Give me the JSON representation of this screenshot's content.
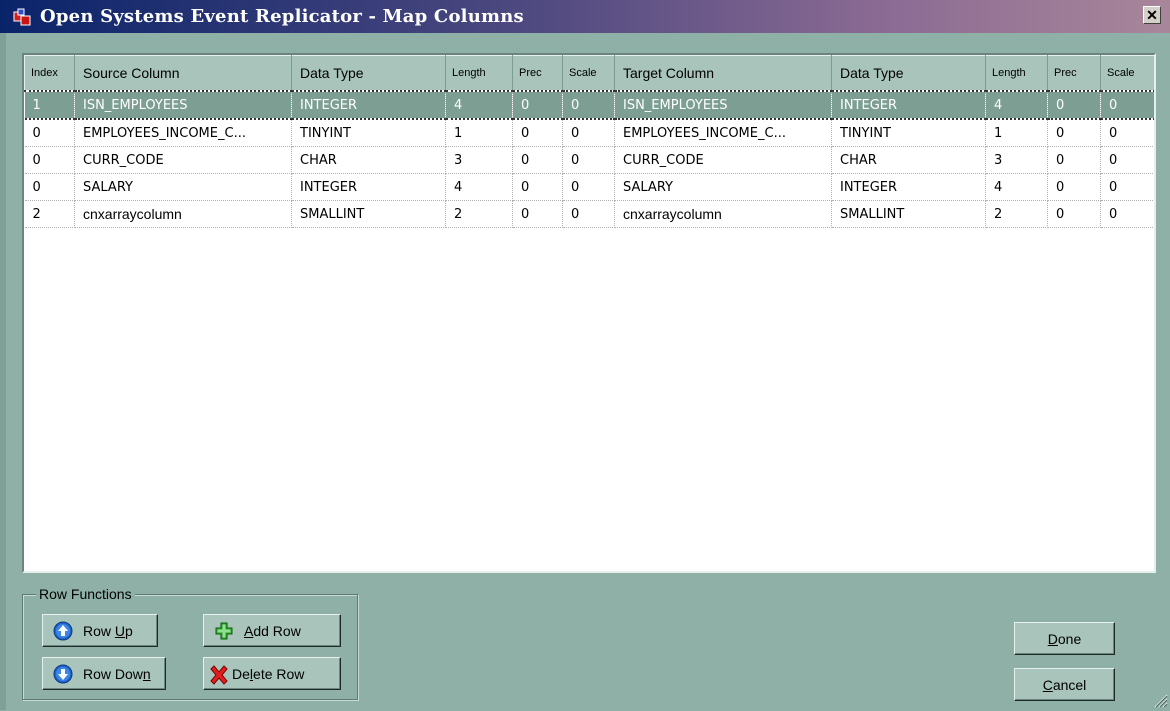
{
  "window": {
    "title": "Open Systems Event Replicator - Map Columns",
    "close_glyph": "✕"
  },
  "grid": {
    "columns": [
      "Index",
      "Source Column",
      "Data Type",
      "Length",
      "Prec",
      "Scale",
      "Target Column",
      "Data Type",
      "Length",
      "Prec",
      "Scale"
    ],
    "rows": [
      [
        "1",
        "ISN_EMPLOYEES",
        "INTEGER",
        "4",
        "0",
        "0",
        "ISN_EMPLOYEES",
        "INTEGER",
        "4",
        "0",
        "0"
      ],
      [
        "0",
        "EMPLOYEES_INCOME_C...",
        "TINYINT",
        "1",
        "0",
        "0",
        "EMPLOYEES_INCOME_C...",
        "TINYINT",
        "1",
        "0",
        "0"
      ],
      [
        "0",
        "CURR_CODE",
        "CHAR",
        "3",
        "0",
        "0",
        "CURR_CODE",
        "CHAR",
        "3",
        "0",
        "0"
      ],
      [
        "0",
        "SALARY",
        "INTEGER",
        "4",
        "0",
        "0",
        "SALARY",
        "INTEGER",
        "4",
        "0",
        "0"
      ],
      [
        "2",
        "cnxarraycolumn",
        "SMALLINT",
        "2",
        "0",
        "0",
        "cnxarraycolumn",
        "SMALLINT",
        "2",
        "0",
        "0"
      ]
    ],
    "selected_row": 0
  },
  "row_functions": {
    "label": "Row Functions",
    "row_up": {
      "pre": "Row ",
      "key": "U",
      "post": "p"
    },
    "row_down": {
      "pre": "Row Dow",
      "key": "n",
      "post": ""
    },
    "add_row": {
      "pre": "",
      "key": "A",
      "post": "dd Row"
    },
    "delete_row": {
      "pre": "De",
      "key": "l",
      "post": "ete Row"
    }
  },
  "buttons": {
    "done": {
      "pre": "",
      "key": "D",
      "post": "one"
    },
    "cancel": {
      "pre": "",
      "key": "C",
      "post": "ancel"
    }
  },
  "colors": {
    "background": "#8fb0a6",
    "header": "#a9c4bb",
    "selection": "#7c9e93"
  }
}
